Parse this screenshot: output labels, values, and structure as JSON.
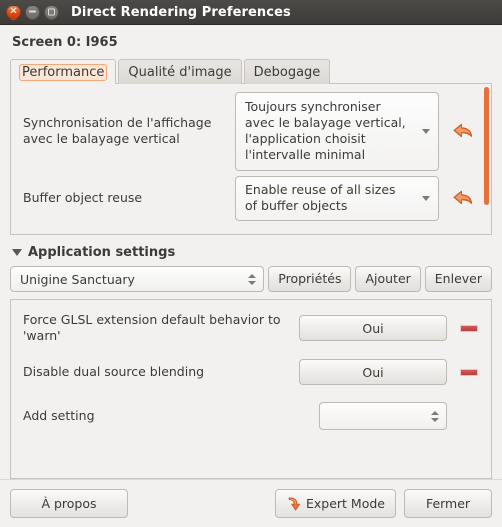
{
  "window": {
    "title": "Direct Rendering Preferences",
    "controls": [
      {
        "name": "close",
        "icon": "close-icon",
        "glyph": "×"
      },
      {
        "name": "minimize",
        "icon": "minimize-icon",
        "glyph": ""
      },
      {
        "name": "maximize",
        "icon": "maximize-icon",
        "glyph": ""
      }
    ]
  },
  "screen": {
    "label": "Screen 0: I965"
  },
  "tabs": [
    {
      "label": "Performance",
      "active": true
    },
    {
      "label": "Qualité d'image",
      "active": false
    },
    {
      "label": "Debogage",
      "active": false
    }
  ],
  "performance": {
    "rows": [
      {
        "label": "Synchronisation de l'affichage avec le balayage vertical",
        "value": "Toujours synchroniser avec le balayage vertical, l'application choisit l'intervalle minimal",
        "revert_icon": "undo-arrow-icon"
      },
      {
        "label": "Buffer object reuse",
        "value": "Enable reuse of all sizes of buffer objects",
        "revert_icon": "undo-arrow-icon"
      }
    ],
    "scrollbar": {
      "icon": "vertical-scrollbar",
      "color": "#e8703a"
    }
  },
  "application_settings": {
    "header": "Application settings",
    "disclosure_icon": "triangle-down-icon",
    "selected_application": "Unigine Sanctuary",
    "buttons": [
      {
        "label": "Propriétés",
        "name": "properties"
      },
      {
        "label": "Ajouter",
        "name": "add"
      },
      {
        "label": "Enlever",
        "name": "remove"
      }
    ],
    "rows": [
      {
        "label": "Force GLSL extension default behavior to 'warn'",
        "control": "button",
        "value": "Oui",
        "remove_icon": "minus-icon",
        "has_remove": true
      },
      {
        "label": "Disable dual source blending",
        "control": "button",
        "value": "Oui",
        "remove_icon": "minus-icon",
        "has_remove": true
      },
      {
        "label": "Add setting",
        "control": "combo",
        "value": "",
        "remove_icon": "minus-icon",
        "has_remove": false
      }
    ]
  },
  "footer": {
    "about_label": "À propos",
    "expert_label": "Expert Mode",
    "expert_icon": "curved-arrow-down-icon",
    "close_label": "Fermer"
  },
  "colors": {
    "accent_orange": "#dd4814",
    "scroll_orange": "#e8703a",
    "remove_red": "#c03b3b",
    "titlebar": "#3d3b37",
    "window_bg": "#f2f1f0"
  }
}
